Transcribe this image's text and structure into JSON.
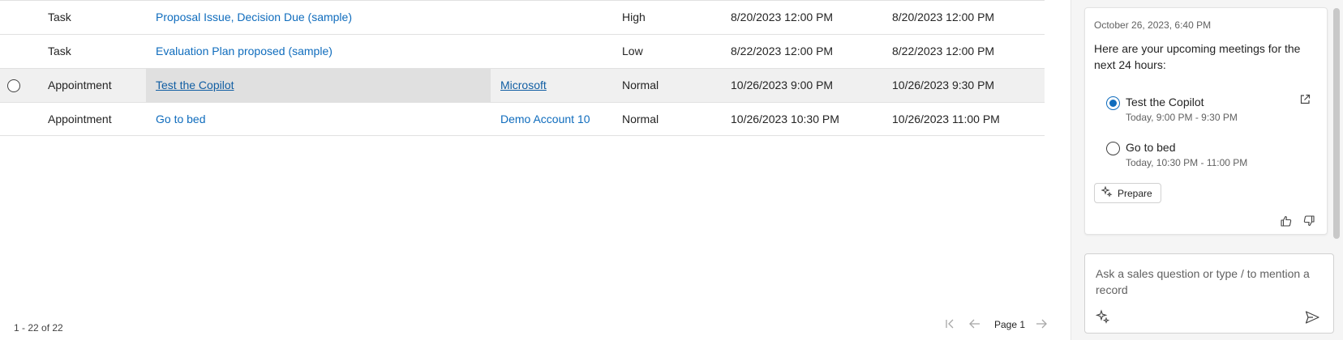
{
  "grid": {
    "rows": [
      {
        "type": "Task",
        "subject": "Proposal Issue, Decision Due (sample)",
        "regarding": "",
        "priority": "High",
        "start": "8/20/2023 12:00 PM",
        "end": "8/20/2023 12:00 PM"
      },
      {
        "type": "Task",
        "subject": "Evaluation Plan proposed (sample)",
        "regarding": "",
        "priority": "Low",
        "start": "8/22/2023 12:00 PM",
        "end": "8/22/2023 12:00 PM"
      },
      {
        "type": "Appointment",
        "subject": "Test the Copilot",
        "regarding": "Microsoft",
        "priority": "Normal",
        "start": "10/26/2023 9:00 PM",
        "end": "10/26/2023 9:30 PM"
      },
      {
        "type": "Appointment",
        "subject": "Go to bed",
        "regarding": "Demo Account 10",
        "priority": "Normal",
        "start": "10/26/2023 10:30 PM",
        "end": "10/26/2023 11:00 PM"
      }
    ],
    "record_count": "1 - 22 of 22",
    "page_label": "Page 1"
  },
  "copilot": {
    "timestamp": "October 26, 2023, 6:40 PM",
    "intro": "Here are your upcoming meetings for the next 24 hours:",
    "meetings": [
      {
        "title": "Test the Copilot",
        "time": "Today, 9:00 PM - 9:30 PM",
        "selected": true
      },
      {
        "title": "Go to bed",
        "time": "Today, 10:30 PM - 11:00 PM",
        "selected": false
      }
    ],
    "prepare_label": "Prepare",
    "ask_placeholder": "Ask a sales question or type / to mention a record"
  },
  "colors": {
    "accent": "#0f6cbd",
    "link": "#0f6cbd",
    "row_hover": "#f0f0f0",
    "cell_selected": "#e0e0e0",
    "panel_bg": "#f5f5f5"
  },
  "icons": [
    "radio-icon",
    "first-page-icon",
    "previous-page-icon",
    "next-page-icon",
    "open-external-icon",
    "sparkle-icon",
    "thumbs-up-icon",
    "thumbs-down-icon",
    "send-icon"
  ]
}
